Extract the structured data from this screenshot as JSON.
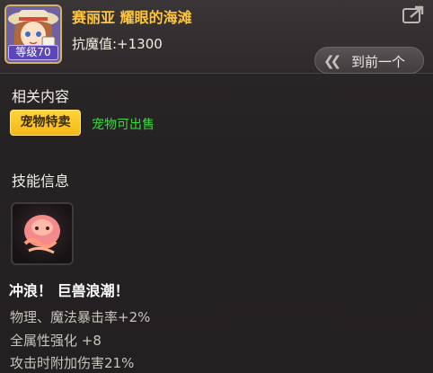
{
  "header": {
    "title": "赛丽亚 耀眼的海滩",
    "resist": "抗魔值:+1300",
    "level_badge": "等级70",
    "prev_button": "到前一个",
    "icons": [
      "character-avatar",
      "share-icon",
      "double-chevron-left-icon"
    ]
  },
  "related": {
    "heading": "相关内容",
    "tag_button": "宠物特卖",
    "tag_note": "宠物可出售"
  },
  "skill": {
    "heading": "技能信息",
    "icon": "pink-creature-wave-icon",
    "name": "冲浪！ 巨兽浪潮！",
    "stats": [
      "物理、魔法暴击率+2%",
      "全属性强化 +8",
      "攻击时附加伤害21%"
    ]
  },
  "colors": {
    "title": "#ffc53a",
    "tag_button_bg": "#ffd43a",
    "tag_note": "#3bd83f",
    "level_badge": "#5b47b8",
    "background": "#232021"
  }
}
